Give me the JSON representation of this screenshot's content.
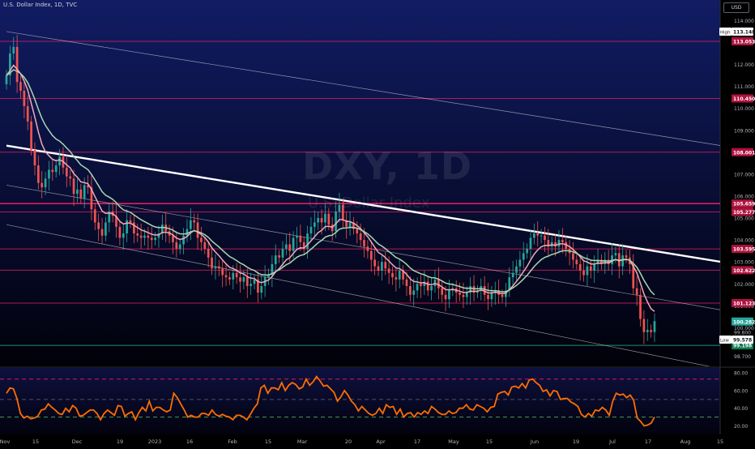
{
  "header": {
    "title": "U.S. Dollar Index, 1D, TVC",
    "currency": "USD"
  },
  "watermark": {
    "symbol": "DXY, 1D",
    "name": "U.S. Dollar Index"
  },
  "colors": {
    "background_top": "#111c63",
    "background_bottom": "#01010a",
    "candle_up": "#26a69a",
    "candle_down": "#ef5350",
    "ma_fast": "#f1a9b6",
    "ma_slow": "#a9d7b1",
    "level_line": "#e91e63",
    "trendline": "#ffffff",
    "rsi_line": "#ff6d00",
    "rsi_upper_band": "#e91e63",
    "rsi_lower_band": "#4caf50",
    "low_line": "#26c281"
  },
  "chart_data": [
    {
      "type": "candlestick",
      "symbol": "DXY",
      "timeframe": "1D",
      "x_start": "2022-11-01",
      "x_ticks": [
        "Nov",
        "15",
        "Dec",
        "19",
        "2023",
        "16",
        "Feb",
        "15",
        "Mar",
        "20",
        "Apr",
        "17",
        "May",
        "15",
        "Jun",
        "19",
        "Jul",
        "17",
        "Aug",
        "15"
      ],
      "y_ticks": [
        "114.000",
        "113.000",
        "112.000",
        "111.000",
        "110.000",
        "109.000",
        "108.000",
        "107.000",
        "106.000",
        "105.000",
        "104.000",
        "103.000",
        "102.000",
        "101.000",
        "100.000",
        "99.800",
        "98.700"
      ],
      "ylim": [
        98.5,
        114.2
      ],
      "series_closes": [
        111.5,
        112.5,
        112.8,
        111.2,
        110.8,
        110.1,
        109.4,
        108.1,
        107.4,
        106.6,
        106.4,
        106.8,
        107.2,
        107.1,
        107.4,
        107.8,
        107.3,
        106.9,
        106.8,
        106.1,
        106.3,
        105.9,
        106.5,
        106.4,
        105.4,
        104.8,
        104.5,
        104.2,
        104.8,
        105.3,
        105.1,
        104.6,
        104.1,
        104.3,
        104.9,
        104.8,
        104.3,
        104.2,
        104.1,
        104.2,
        104.1,
        104.0,
        104.1,
        104.3,
        104.7,
        104.4,
        104.2,
        103.9,
        103.6,
        103.8,
        104.2,
        104.5,
        104.9,
        104.8,
        104.1,
        103.9,
        103.6,
        103.2,
        102.7,
        102.8,
        102.7,
        102.4,
        102.3,
        102.2,
        102.5,
        102.3,
        102.1,
        102.3,
        101.9,
        102.0,
        102.2,
        101.6,
        101.9,
        102.3,
        102.4,
        102.9,
        103.3,
        103.2,
        103.6,
        103.8,
        103.5,
        104.1,
        104.2,
        103.9,
        103.6,
        104.3,
        104.6,
        104.8,
        105.0,
        104.8,
        105.2,
        104.7,
        104.4,
        105.3,
        105.6,
        104.9,
        104.6,
        104.8,
        104.5,
        104.3,
        104.0,
        103.7,
        103.5,
        103.1,
        102.8,
        102.6,
        103.0,
        102.7,
        102.5,
        102.3,
        102.2,
        102.6,
        102.2,
        101.9,
        101.5,
        101.7,
        102.0,
        101.9,
        102.1,
        101.7,
        101.9,
        102.2,
        101.8,
        101.5,
        101.3,
        101.7,
        101.8,
        101.6,
        101.5,
        101.4,
        101.6,
        101.9,
        101.6,
        101.7,
        101.9,
        101.5,
        101.3,
        101.6,
        101.7,
        101.5,
        101.4,
        101.7,
        102.3,
        102.5,
        102.8,
        103.1,
        103.4,
        103.6,
        104.1,
        104.3,
        104.2,
        104.2,
        104.0,
        103.7,
        103.9,
        103.7,
        104.0,
        103.9,
        103.6,
        103.4,
        103.1,
        102.9,
        102.6,
        102.4,
        102.8,
        102.6,
        102.9,
        103.1,
        102.9,
        103.1,
        102.9,
        103.3,
        103.4,
        102.8,
        103.3,
        103.2,
        102.9,
        101.8,
        101.5,
        100.4,
        99.8,
        99.9,
        99.8,
        100.3
      ],
      "moving_averages": [
        {
          "name": "fast",
          "color": "#f1a9b6"
        },
        {
          "name": "slow",
          "color": "#a9d7b1"
        }
      ],
      "horizontal_levels": [
        113.053,
        110.45,
        108.001,
        105.659,
        105.277,
        103.595,
        102.622,
        101.123,
        99.198
      ],
      "price_labels": [
        {
          "text": "113.053",
          "value": 113.053,
          "style": "level"
        },
        {
          "text": "110.450",
          "value": 110.45,
          "style": "level"
        },
        {
          "text": "108.001",
          "value": 108.001,
          "style": "level"
        },
        {
          "text": "105.659",
          "value": 105.659,
          "style": "level"
        },
        {
          "text": "105.277",
          "value": 105.277,
          "style": "level"
        },
        {
          "text": "103.595",
          "value": 103.595,
          "style": "level"
        },
        {
          "text": "102.622",
          "value": 102.622,
          "style": "level"
        },
        {
          "text": "101.123",
          "value": 101.123,
          "style": "level"
        },
        {
          "text": "100.282",
          "value": 100.282,
          "style": "last"
        },
        {
          "text": "99.198",
          "value": 99.198,
          "style": "low-level"
        }
      ],
      "high": {
        "label": "High",
        "value": "113.148"
      },
      "low": {
        "label": "Low",
        "value": "99.578"
      },
      "last_price": "100.282",
      "trendlines": [
        {
          "style": "bold",
          "points": [
            [
              "2022-11-01",
              108.3
            ],
            [
              "2023-08-16",
              102.9
            ]
          ]
        },
        {
          "style": "thin",
          "points": [
            [
              "2022-11-01",
              113.5
            ],
            [
              "2023-08-16",
              108.2
            ]
          ]
        },
        {
          "style": "thin",
          "points": [
            [
              "2022-11-01",
              106.5
            ],
            [
              "2023-08-16",
              100.7
            ]
          ]
        },
        {
          "style": "thin",
          "points": [
            [
              "2022-11-01",
              104.7
            ],
            [
              "2023-08-16",
              98.0
            ]
          ]
        }
      ]
    },
    {
      "type": "line",
      "indicator": "RSI",
      "y_ticks": [
        "80.00",
        "60.00",
        "40.00",
        "20.00"
      ],
      "ylim": [
        14,
        82
      ],
      "bands": [
        73,
        50,
        30
      ],
      "values": [
        57,
        63,
        62,
        51,
        34,
        29,
        31,
        28,
        29,
        31,
        38,
        39,
        45,
        41,
        38,
        34,
        33,
        40,
        36,
        43,
        40,
        31,
        32,
        35,
        38,
        38,
        34,
        27,
        34,
        38,
        35,
        32,
        43,
        42,
        31,
        34,
        36,
        27,
        35,
        41,
        37,
        48,
        37,
        41,
        41,
        38,
        36,
        38,
        57,
        52,
        45,
        38,
        30,
        32,
        30,
        30,
        34,
        34,
        32,
        38,
        33,
        31,
        33,
        31,
        30,
        27,
        32,
        32,
        30,
        27,
        33,
        40,
        45,
        63,
        66,
        57,
        63,
        63,
        61,
        69,
        60,
        66,
        69,
        67,
        62,
        64,
        73,
        66,
        70,
        76,
        71,
        65,
        66,
        62,
        58,
        48,
        53,
        60,
        55,
        48,
        44,
        37,
        42,
        38,
        34,
        32,
        34,
        40,
        34,
        44,
        41,
        42,
        33,
        39,
        30,
        34,
        35,
        30,
        35,
        33,
        37,
        34,
        42,
        39,
        35,
        33,
        33,
        37,
        34,
        35,
        40,
        40,
        44,
        39,
        38,
        44,
        42,
        40,
        36,
        41,
        42,
        56,
        58,
        59,
        55,
        64,
        65,
        63,
        68,
        63,
        72,
        73,
        69,
        66,
        59,
        61,
        54,
        60,
        59,
        50,
        51,
        51,
        47,
        45,
        42,
        33,
        30,
        34,
        31,
        38,
        37,
        41,
        38,
        32,
        48,
        57,
        55,
        56,
        52,
        55,
        49,
        29,
        25,
        20,
        21,
        23,
        30
      ]
    }
  ]
}
